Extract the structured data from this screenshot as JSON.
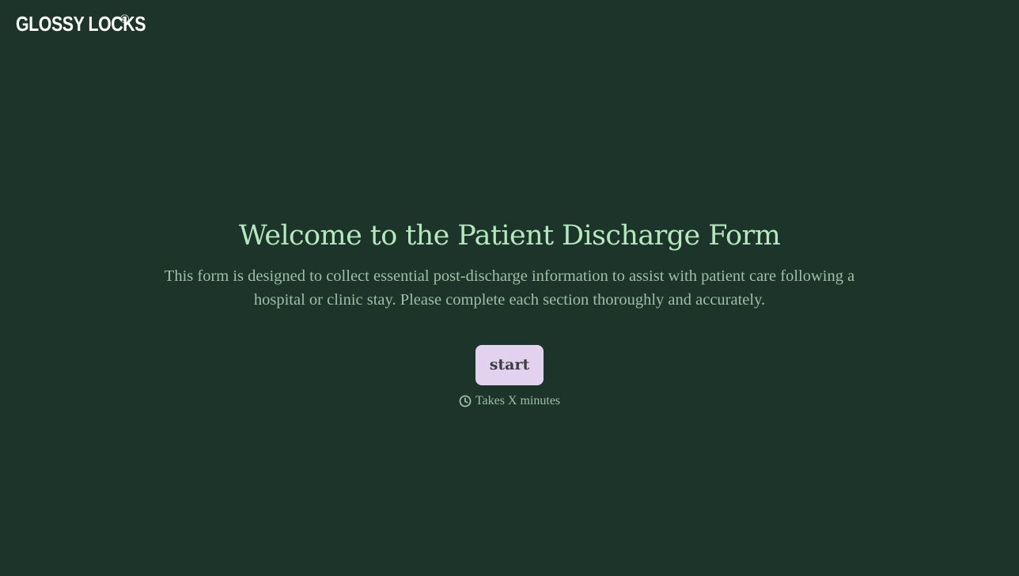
{
  "brand": {
    "name": "GLOSSY LOCKS",
    "mark": "©"
  },
  "hero": {
    "title": "Welcome to the Patient Discharge Form",
    "description": "This form is designed to collect essential post-discharge information to assist with patient care following a hospital or clinic stay. Please complete each section thoroughly and accurately.",
    "start_label": "start",
    "duration_icon": "clock-icon",
    "duration_text": "Takes X minutes"
  },
  "colors": {
    "background": "#1c3429",
    "title": "#b6e8c0",
    "body_text": "#9fbfa7",
    "button_bg": "#e2d1ef",
    "button_text": "#3b3f3e"
  }
}
